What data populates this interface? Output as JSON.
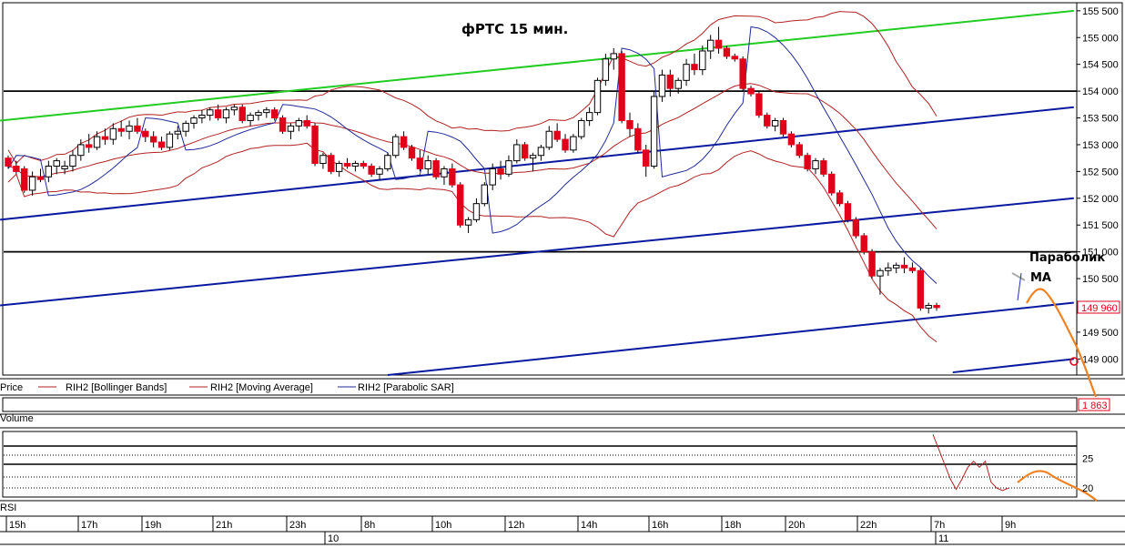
{
  "chart_data": {
    "type": "candlestick",
    "title": "фРТС  15 мин.",
    "symbol": "RIH2",
    "price_axis": {
      "ylim": [
        148700,
        155650
      ],
      "ticks": [
        "155 500",
        "155 000",
        "154 500",
        "154 000",
        "153 500",
        "153 000",
        "152 500",
        "152 000",
        "151 500",
        "151 000",
        "150 500",
        "150 000",
        "149 500",
        "149 000"
      ],
      "tick_values": [
        155500,
        155000,
        154500,
        154000,
        153500,
        153000,
        152500,
        152000,
        151500,
        151000,
        150500,
        150000,
        149500,
        149000
      ],
      "last_price_label": "149 960",
      "last_price": 149960
    },
    "legend": [
      {
        "label": "Price",
        "color": "#000000"
      },
      {
        "label": "RIH2 [Bollinger Bands]",
        "color": "#b22222"
      },
      {
        "label": "RIH2 [Moving Average]",
        "color": "#b22222"
      },
      {
        "label": "RIH2 [Parabolic SAR]",
        "color": "#1f2a9a"
      }
    ],
    "volume_panel": {
      "label": "Volume",
      "value_label": "1 863"
    },
    "rsi_panel": {
      "label": "RSI",
      "ticks": [
        "25",
        "20"
      ],
      "tick_values": [
        25,
        20
      ],
      "ylim": [
        18.5,
        29.5
      ]
    },
    "time_axis": {
      "hour_labels": [
        "15h",
        "17h",
        "19h",
        "21h",
        "23h",
        "8h",
        "10h",
        "12h",
        "14h",
        "16h",
        "18h",
        "20h",
        "22h",
        "7h",
        "9h"
      ],
      "date_labels": [
        "10",
        "11"
      ]
    },
    "annotations": [
      {
        "text": "Параболик"
      },
      {
        "text": "МА"
      }
    ],
    "horizontal_levels": [
      154000,
      151000
    ],
    "colors": {
      "bull": "#ffffff",
      "bear": "#e0001a",
      "bollinger": "#b22222",
      "sar": "#1f2a9a",
      "channel": "#0a1aa0",
      "trend_up": "#22cc22",
      "forecast": "#f08020"
    },
    "candles": [
      [
        152750,
        152800,
        152550,
        152600
      ],
      [
        152600,
        152700,
        152450,
        152500
      ],
      [
        152550,
        152600,
        152100,
        152150
      ],
      [
        152150,
        152500,
        152050,
        152400
      ],
      [
        152400,
        152550,
        152300,
        152350
      ],
      [
        152400,
        152700,
        152300,
        152600
      ],
      [
        152600,
        152750,
        152450,
        152700
      ],
      [
        152550,
        152700,
        152450,
        152600
      ],
      [
        152600,
        152900,
        152500,
        152800
      ],
      [
        152800,
        153100,
        152700,
        153000
      ],
      [
        153000,
        153200,
        152850,
        152950
      ],
      [
        152950,
        153250,
        152900,
        153150
      ],
      [
        153150,
        153300,
        153000,
        153100
      ],
      [
        153100,
        153400,
        153000,
        153300
      ],
      [
        153300,
        153450,
        153150,
        153250
      ],
      [
        153250,
        153450,
        153100,
        153350
      ],
      [
        153350,
        153500,
        153200,
        153250
      ],
      [
        153250,
        153300,
        153050,
        153150
      ],
      [
        153150,
        153250,
        152950,
        153050
      ],
      [
        153050,
        153150,
        152900,
        152950
      ],
      [
        152950,
        153250,
        152900,
        153200
      ],
      [
        153200,
        153350,
        153100,
        153250
      ],
      [
        153250,
        153450,
        153150,
        153400
      ],
      [
        153400,
        153550,
        153300,
        153500
      ],
      [
        153500,
        153650,
        153400,
        153550
      ],
      [
        153550,
        153700,
        153450,
        153650
      ],
      [
        153650,
        153750,
        153450,
        153500
      ],
      [
        153500,
        153700,
        153400,
        153650
      ],
      [
        153650,
        153750,
        153550,
        153700
      ],
      [
        153700,
        153750,
        153400,
        153450
      ],
      [
        153450,
        153600,
        153350,
        153550
      ],
      [
        153550,
        153650,
        153450,
        153600
      ],
      [
        153600,
        153700,
        153500,
        153650
      ],
      [
        153650,
        153700,
        153450,
        153500
      ],
      [
        153500,
        153550,
        153200,
        153250
      ],
      [
        153250,
        153400,
        153100,
        153350
      ],
      [
        153350,
        153500,
        153250,
        153450
      ],
      [
        153450,
        153550,
        153300,
        153350
      ],
      [
        153350,
        153400,
        152600,
        152650
      ],
      [
        152650,
        152850,
        152550,
        152800
      ],
      [
        152800,
        152850,
        152450,
        152500
      ],
      [
        152500,
        152700,
        152400,
        152650
      ],
      [
        152650,
        152750,
        152550,
        152600
      ],
      [
        152600,
        152700,
        152500,
        152650
      ],
      [
        152650,
        152700,
        152550,
        152600
      ],
      [
        152600,
        152650,
        152400,
        152450
      ],
      [
        152450,
        152600,
        152350,
        152550
      ],
      [
        152550,
        152850,
        152500,
        152800
      ],
      [
        152800,
        153200,
        152750,
        153150
      ],
      [
        153150,
        153250,
        152900,
        152950
      ],
      [
        152950,
        153000,
        152700,
        152750
      ],
      [
        152750,
        152900,
        152500,
        152550
      ],
      [
        152550,
        152800,
        152450,
        152700
      ],
      [
        152700,
        152750,
        152350,
        152400
      ],
      [
        152400,
        152600,
        152250,
        152550
      ],
      [
        152550,
        152650,
        152200,
        152250
      ],
      [
        152250,
        152300,
        151450,
        151500
      ],
      [
        151500,
        151650,
        151350,
        151600
      ],
      [
        151600,
        152000,
        151550,
        151900
      ],
      [
        151900,
        152300,
        151850,
        152250
      ],
      [
        152250,
        152650,
        152150,
        152550
      ],
      [
        152550,
        152700,
        152350,
        152450
      ],
      [
        152450,
        152800,
        152400,
        152700
      ],
      [
        152700,
        153100,
        152650,
        153000
      ],
      [
        153000,
        153050,
        152700,
        152750
      ],
      [
        152750,
        152850,
        152500,
        152800
      ],
      [
        152800,
        153000,
        152700,
        152950
      ],
      [
        152950,
        153350,
        152900,
        153250
      ],
      [
        153250,
        153400,
        153050,
        153100
      ],
      [
        153100,
        153200,
        152850,
        152900
      ],
      [
        152900,
        153200,
        152850,
        153150
      ],
      [
        153150,
        153500,
        153100,
        153450
      ],
      [
        153450,
        153700,
        153350,
        153600
      ],
      [
        153600,
        154250,
        153550,
        154200
      ],
      [
        154200,
        154700,
        154100,
        154600
      ],
      [
        154600,
        154800,
        154400,
        154700
      ],
      [
        154700,
        154750,
        153400,
        153450
      ],
      [
        153450,
        153600,
        153150,
        153300
      ],
      [
        153300,
        153400,
        152850,
        152900
      ],
      [
        152900,
        153000,
        152400,
        152600
      ],
      [
        152600,
        154000,
        152550,
        153900
      ],
      [
        153900,
        154400,
        153800,
        154300
      ],
      [
        154300,
        154400,
        153900,
        154050
      ],
      [
        154050,
        154250,
        153950,
        154200
      ],
      [
        154200,
        154600,
        154100,
        154500
      ],
      [
        154500,
        154700,
        154300,
        154400
      ],
      [
        154400,
        154850,
        154300,
        154750
      ],
      [
        154750,
        155050,
        154600,
        154950
      ],
      [
        154950,
        155200,
        154700,
        154800
      ],
      [
        154800,
        154850,
        154600,
        154650
      ],
      [
        154650,
        154700,
        154550,
        154600
      ],
      [
        154600,
        154650,
        154000,
        154050
      ],
      [
        154050,
        154100,
        153900,
        153950
      ],
      [
        153950,
        154000,
        153500,
        153550
      ],
      [
        153550,
        153600,
        153300,
        153350
      ],
      [
        153350,
        153500,
        153250,
        153450
      ],
      [
        153450,
        153500,
        153150,
        153200
      ],
      [
        153200,
        153250,
        152950,
        153000
      ],
      [
        153000,
        153050,
        152750,
        152800
      ],
      [
        152800,
        152850,
        152500,
        152550
      ],
      [
        152550,
        152750,
        152450,
        152700
      ],
      [
        152700,
        152750,
        152400,
        152450
      ],
      [
        152450,
        152500,
        152050,
        152100
      ],
      [
        152100,
        152150,
        151850,
        151900
      ],
      [
        151900,
        151950,
        151550,
        151600
      ],
      [
        151600,
        151650,
        151250,
        151300
      ],
      [
        151300,
        151350,
        150950,
        151000
      ],
      [
        151000,
        151050,
        150500,
        150550
      ],
      [
        150550,
        150700,
        150200,
        150650
      ],
      [
        150650,
        150800,
        150550,
        150700
      ],
      [
        150700,
        150800,
        150600,
        150750
      ],
      [
        150750,
        150900,
        150600,
        150700
      ],
      [
        150700,
        150800,
        150600,
        150650
      ],
      [
        150650,
        150700,
        149900,
        149950
      ],
      [
        149950,
        150050,
        149850,
        150000
      ],
      [
        150000,
        150050,
        149900,
        149960
      ]
    ],
    "rsi": [
      29,
      26.5,
      24,
      21.5,
      19.8,
      21.5,
      23.5,
      24.5,
      23.5,
      24.5,
      21,
      20,
      19.6,
      20
    ]
  },
  "forecast_note": ""
}
